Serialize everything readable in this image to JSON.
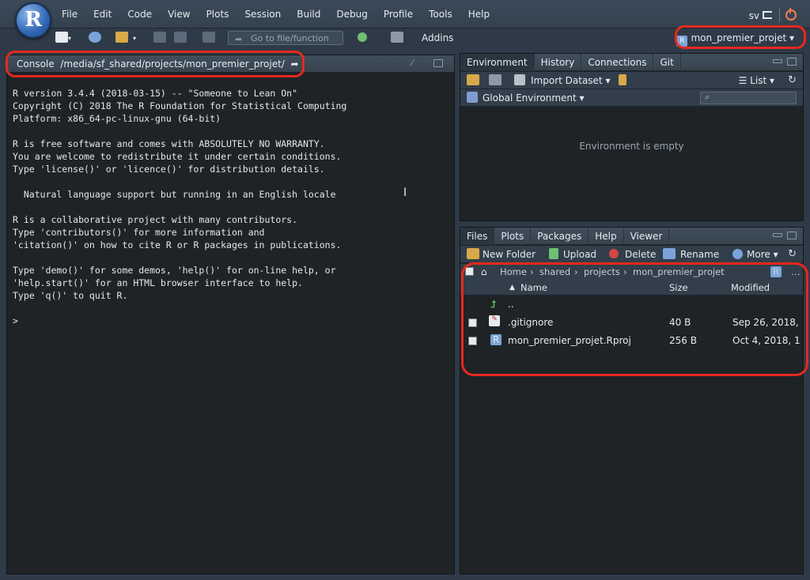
{
  "app": {
    "logo_letter": "R"
  },
  "menu": [
    "File",
    "Edit",
    "Code",
    "View",
    "Plots",
    "Session",
    "Build",
    "Debug",
    "Profile",
    "Tools",
    "Help"
  ],
  "user": {
    "name": "sv"
  },
  "toolbar": {
    "goto_placeholder": "Go to file/function",
    "addins_label": "Addins",
    "project_label": "mon_premier_projet"
  },
  "console": {
    "title": "Console",
    "path": "/media/sf_shared/projects/mon_premier_projet/",
    "output": "R version 3.4.4 (2018-03-15) -- \"Someone to Lean On\"\nCopyright (C) 2018 The R Foundation for Statistical Computing\nPlatform: x86_64-pc-linux-gnu (64-bit)\n\nR is free software and comes with ABSOLUTELY NO WARRANTY.\nYou are welcome to redistribute it under certain conditions.\nType 'license()' or 'licence()' for distribution details.\n\n  Natural language support but running in an English locale\n\nR is a collaborative project with many contributors.\nType 'contributors()' for more information and\n'citation()' on how to cite R or R packages in publications.\n\nType 'demo()' for some demos, 'help()' for on-line help, or\n'help.start()' for an HTML browser interface to help.\nType 'q()' to quit R.\n\n>"
  },
  "env_pane": {
    "tabs": [
      "Environment",
      "History",
      "Connections",
      "Git"
    ],
    "import_label": "Import Dataset",
    "list_label": "List",
    "scope_label": "Global Environment",
    "empty_text": "Environment is empty"
  },
  "files_pane": {
    "tabs": [
      "Files",
      "Plots",
      "Packages",
      "Help",
      "Viewer"
    ],
    "actions": {
      "new_folder": "New Folder",
      "upload": "Upload",
      "delete": "Delete",
      "rename": "Rename",
      "more": "More"
    },
    "breadcrumb": [
      "Home",
      "shared",
      "projects",
      "mon_premier_projet"
    ],
    "columns": {
      "name": "Name",
      "size": "Size",
      "modified": "Modified"
    },
    "parent": "..",
    "rows": [
      {
        "name": ".gitignore",
        "size": "40 B",
        "modified": "Sep 26, 2018,"
      },
      {
        "name": "mon_premier_projet.Rproj",
        "size": "256 B",
        "modified": "Oct 4, 2018, 1"
      }
    ]
  }
}
